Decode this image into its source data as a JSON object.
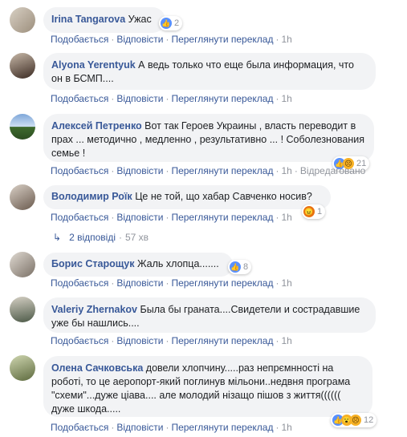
{
  "actions": {
    "like": "Подобається",
    "reply": "Відповісти",
    "translate": "Переглянути переклад",
    "edited": "Відредаговано",
    "sep": "·"
  },
  "comments": [
    {
      "author": "Irina Tangarova",
      "text": "Ужас",
      "time": "1h",
      "reactions": {
        "icons": [
          "like-icon"
        ],
        "count": "2"
      },
      "avatar_color": "#b8aa96"
    },
    {
      "author": "Alyona Yerentyuk",
      "text": "А ведь только что еще была информация, что он в БСМП....",
      "time": "1h",
      "avatar_color": "#6f5a4a"
    },
    {
      "author": "Алексей Петренко",
      "text": "Вот так Героев Украины , власть переводит в прах ... методично , медленно , результативно ... ! Соболезнования семье !",
      "time": "1h",
      "reactions": {
        "icons": [
          "like-icon",
          "sad-icon"
        ],
        "count": "21"
      },
      "avatar_color": "#4a74b4"
    },
    {
      "author": "Володимир Роїк",
      "text": "Це не той, що хабар Савченко носив?",
      "time": "1h",
      "reactions": {
        "icons": [
          "angry-icon"
        ],
        "count": "1"
      },
      "avatar_color": "#8a7a6c",
      "replies": {
        "label": "2 відповіді",
        "time": "57 хв"
      }
    },
    {
      "author": "Борис Старощук",
      "text": "Жаль хлопца.......",
      "time": "1h",
      "reactions": {
        "icons": [
          "like-icon"
        ],
        "count": "8"
      },
      "avatar_color": "#9c9488"
    },
    {
      "author": "Valeriy Zhernakov",
      "text": "Была бы граната....Свидетели и сострадавшие уже бы нашлись....",
      "time": "1h",
      "avatar_color": "#5b6b55"
    },
    {
      "author": "Олена Сачковська",
      "text": "довели хлопчину.....раз непрємнності на роботі, то це аеропорт-який поглинув мільони..недвня програма \"схеми\"...дуже ціава.... але молодий нізащо пішов з життя(((((( дуже шкода.....",
      "time": "1h",
      "reactions": {
        "icons": [
          "like-icon",
          "wow-icon",
          "sad-icon"
        ],
        "count": "12"
      },
      "avatar_color": "#7d8a5e"
    }
  ]
}
